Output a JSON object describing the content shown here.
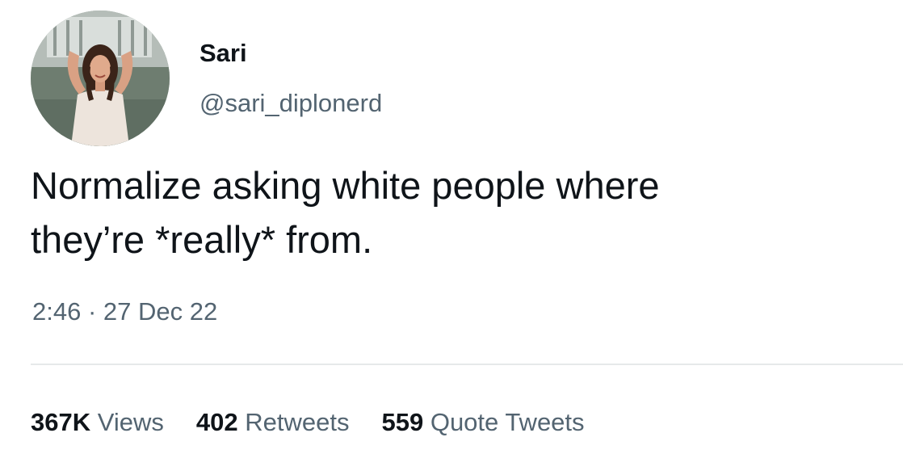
{
  "author": {
    "display_name": "Sari",
    "handle": "@sari_diplonerd"
  },
  "tweet": {
    "text_lines": [
      "Normalize asking white people where",
      "they’re *really* from."
    ],
    "time": "2:46",
    "separator": "·",
    "date": "27 Dec 22"
  },
  "stats": [
    {
      "count": "367K",
      "label": "Views"
    },
    {
      "count": "402",
      "label": "Retweets"
    },
    {
      "count": "559",
      "label": "Quote Tweets"
    }
  ],
  "colors": {
    "text_primary": "#0f1419",
    "text_secondary": "#536471",
    "divider": "#e6e9ea"
  }
}
